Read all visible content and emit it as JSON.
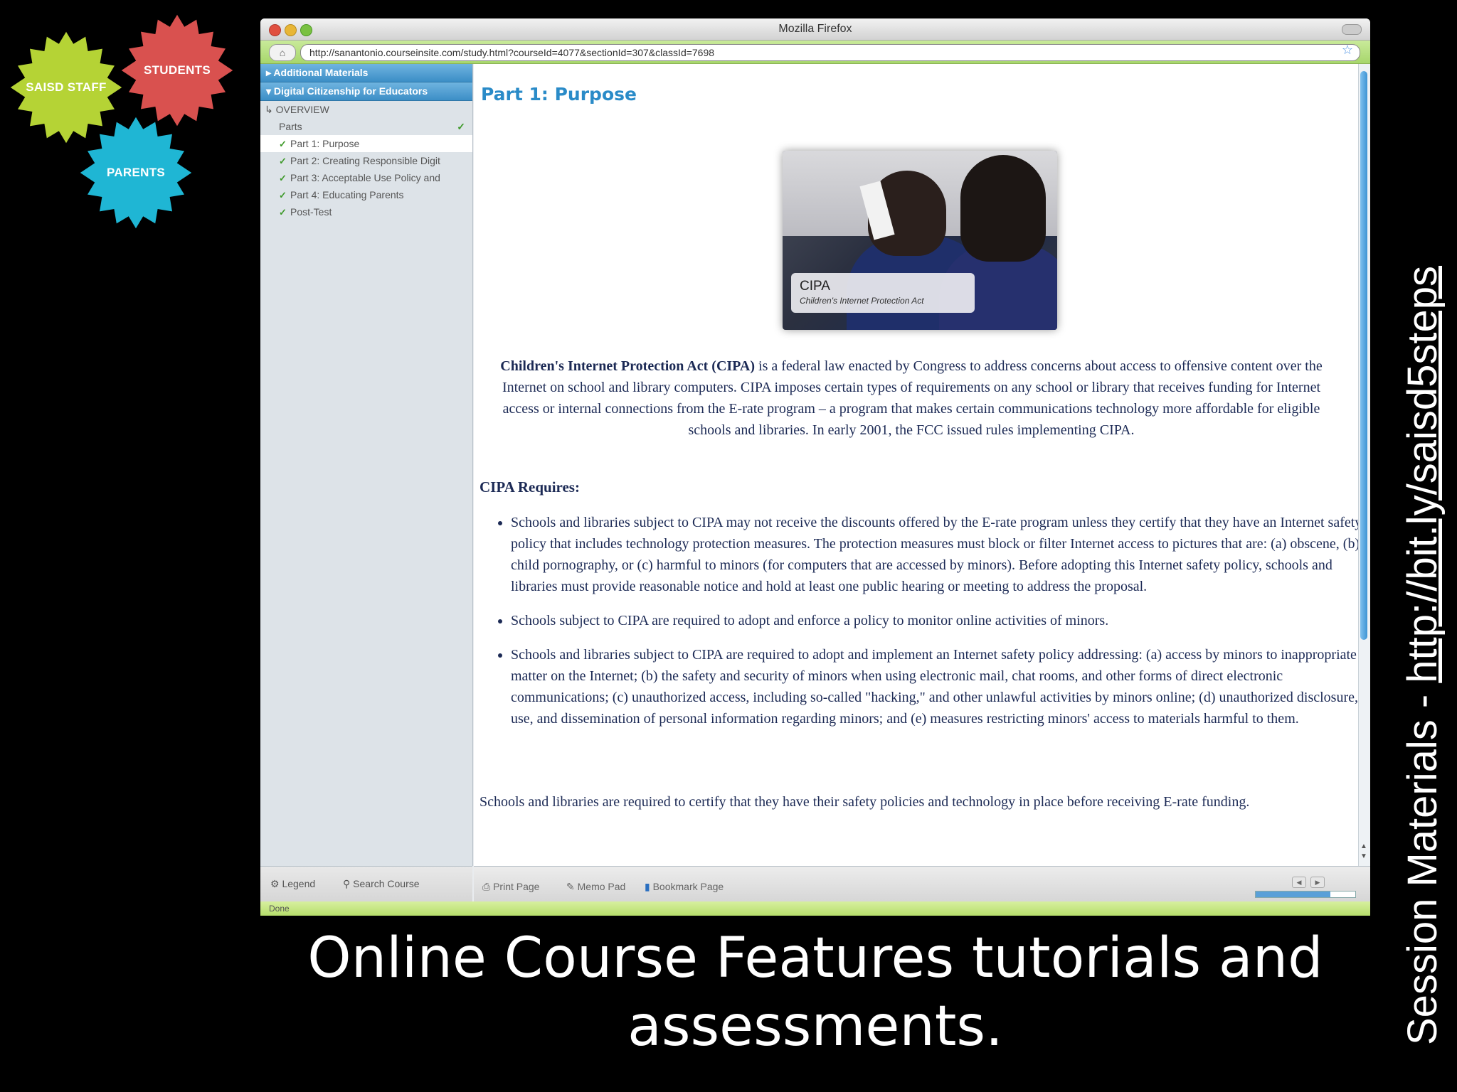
{
  "gears": {
    "staff": {
      "label": "SAISD STAFF",
      "color": "#b5d335"
    },
    "students": {
      "label": "STUDENTS",
      "color": "#d9514f"
    },
    "parents": {
      "label": "PARENTS",
      "color": "#1fb6d4"
    }
  },
  "browser": {
    "title": "Mozilla Firefox",
    "url": "http://sanantonio.courseinsite.com/study.html?courseId=4077&sectionId=307&classId=7698",
    "status": "Done"
  },
  "sidebar": {
    "accordions": [
      "Additional Materials",
      "Digital Citizenship for Educators"
    ],
    "overview": "OVERVIEW",
    "parts_label": "Parts",
    "items": [
      "Part 1: Purpose",
      "Part 2: Creating Responsible Digit",
      "Part 3: Acceptable Use Policy and",
      "Part 4: Educating Parents",
      "Post-Test"
    ],
    "footer": {
      "legend": "Legend",
      "search": "Search Course"
    }
  },
  "content": {
    "heading": "Part 1: Purpose",
    "image_caption_title": "CIPA",
    "image_caption_subtitle": "Children's Internet Protection Act",
    "intro_bold": "Children's Internet Protection Act (CIPA)",
    "intro_rest": " is a federal law enacted by Congress to address concerns about access to offensive content over the Internet on school and library computers. CIPA imposes certain types of requirements on any school or library that receives funding for Internet access or internal connections from the E-rate program – a program that makes certain communications technology more affordable for eligible schools and libraries. In early 2001, the FCC issued rules implementing CIPA.",
    "requires_heading": "CIPA Requires:",
    "requirements": [
      "Schools and libraries subject to CIPA may not receive the discounts offered by the E-rate program unless they certify that they have an Internet safety policy that includes technology protection measures. The protection measures must block or filter Internet access to pictures that are: (a) obscene, (b) child pornography, or (c) harmful to minors (for computers that are accessed by minors). Before adopting this Internet safety policy, schools and libraries must provide reasonable notice and hold at least one public hearing or meeting to address the proposal.",
      "Schools subject to CIPA are required to adopt and enforce a policy to monitor online activities of minors.",
      "Schools and libraries subject to CIPA are required to adopt and implement an Internet safety policy addressing: (a) access by minors to inappropriate matter on the Internet; (b) the safety and security of minors when using electronic mail, chat rooms, and other forms of direct electronic communications; (c) unauthorized access, including so-called \"hacking,\" and other unlawful activities by minors online; (d) unauthorized disclosure, use, and dissemination of personal information regarding minors; and (e) measures restricting minors' access to materials harmful to them."
    ],
    "closing": "Schools and libraries are required to certify that they have their safety policies and technology in place before receiving E-rate funding."
  },
  "content_footer": {
    "print": "Print Page",
    "memo": "Memo Pad",
    "bookmark": "Bookmark Page",
    "progress": 0.75
  },
  "slide": {
    "caption": "Online Course Features tutorials and assessments.",
    "side_prefix": "Session Materials - ",
    "side_link": "http://bit.ly/saisd5steps"
  }
}
